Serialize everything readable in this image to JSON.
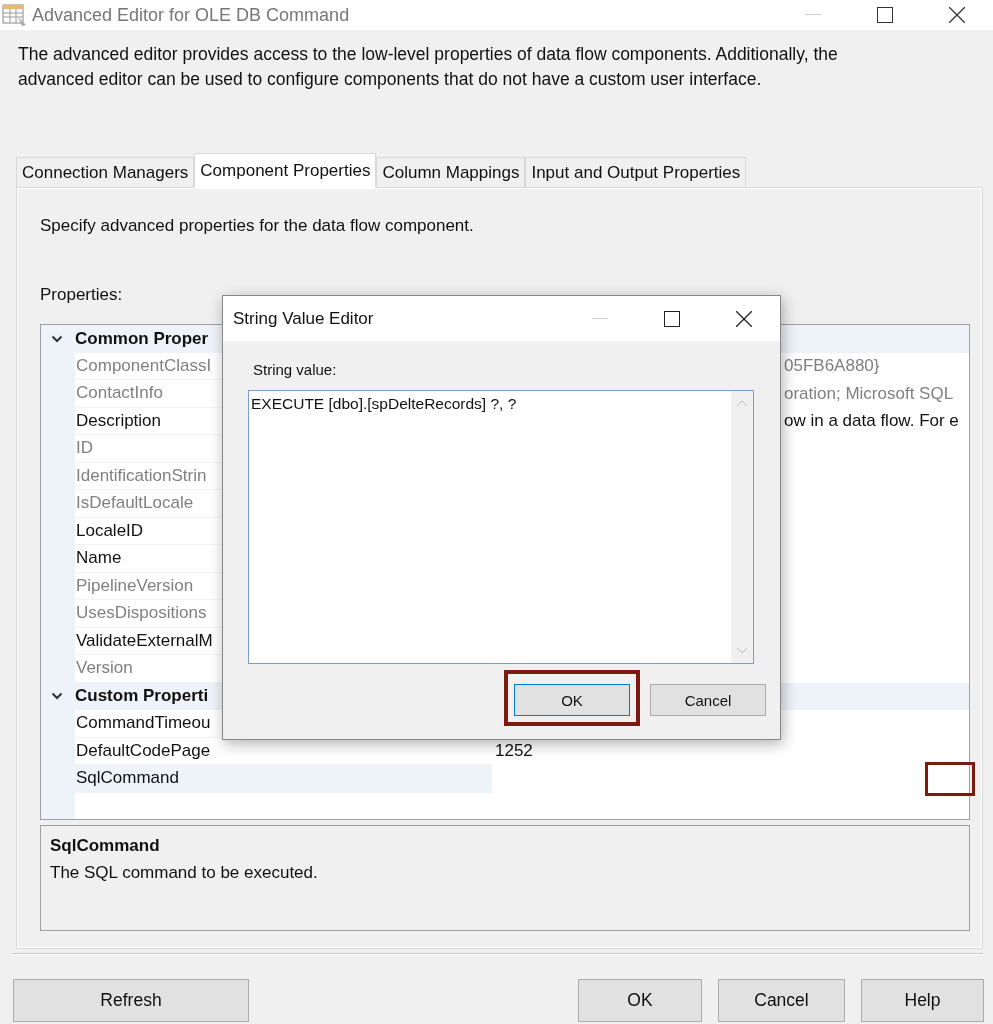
{
  "window": {
    "title": "Advanced Editor for OLE DB Command"
  },
  "intro": "The advanced editor provides access to the low-level properties of data flow components. Additionally, the advanced editor can be used to configure components that do not have a custom user interface.",
  "tabs": [
    {
      "label": "Connection Managers",
      "selected": false
    },
    {
      "label": "Component Properties",
      "selected": true
    },
    {
      "label": "Column Mappings",
      "selected": false
    },
    {
      "label": "Input and Output Properties",
      "selected": false
    }
  ],
  "panel": {
    "instruction": "Specify advanced properties for the data flow component.",
    "properties_label": "Properties:"
  },
  "property_grid": {
    "groups": [
      {
        "name": "Common Proper",
        "expanded": true,
        "rows": [
          {
            "name": "ComponentClassI",
            "value": "05FB6A880}",
            "readonly": true,
            "selected": false
          },
          {
            "name": "ContactInfo",
            "value": "oration; Microsoft SQL",
            "readonly": true,
            "selected": false
          },
          {
            "name": "Description",
            "value": "ow in a data flow. For e",
            "readonly": false,
            "selected": false
          },
          {
            "name": "ID",
            "readonly": true,
            "selected": false
          },
          {
            "name": "IdentificationStrin",
            "readonly": true,
            "selected": false
          },
          {
            "name": "IsDefaultLocale",
            "readonly": true,
            "selected": false
          },
          {
            "name": "LocaleID",
            "readonly": false,
            "selected": false
          },
          {
            "name": "Name",
            "readonly": false,
            "selected": false
          },
          {
            "name": "PipelineVersion",
            "readonly": true,
            "selected": false
          },
          {
            "name": "UsesDispositions",
            "readonly": true,
            "selected": false
          },
          {
            "name": "ValidateExternalM",
            "readonly": false,
            "selected": false
          },
          {
            "name": "Version",
            "readonly": true,
            "selected": false
          }
        ]
      },
      {
        "name": "Custom Properti",
        "expanded": true,
        "rows": [
          {
            "name": "CommandTimeou",
            "readonly": false,
            "selected": false
          },
          {
            "name": "DefaultCodePage",
            "value": "1252",
            "readonly": false,
            "selected": false
          },
          {
            "name": "SqlCommand",
            "readonly": false,
            "selected": true,
            "annotated": true
          }
        ]
      }
    ]
  },
  "description_pane": {
    "title": "SqlCommand",
    "text": "The SQL command to be executed."
  },
  "footer": {
    "left_buttons": [
      {
        "label": "Refresh"
      }
    ],
    "right_buttons": [
      {
        "label": "OK"
      },
      {
        "label": "Cancel"
      },
      {
        "label": "Help"
      }
    ]
  },
  "dialog": {
    "title": "String Value Editor",
    "field_label": "String value:",
    "value": "EXECUTE [dbo].[spDelteRecords] ?, ?",
    "buttons": [
      {
        "label": "OK",
        "default": true,
        "annotated": true
      },
      {
        "label": "Cancel",
        "default": false
      }
    ]
  }
}
